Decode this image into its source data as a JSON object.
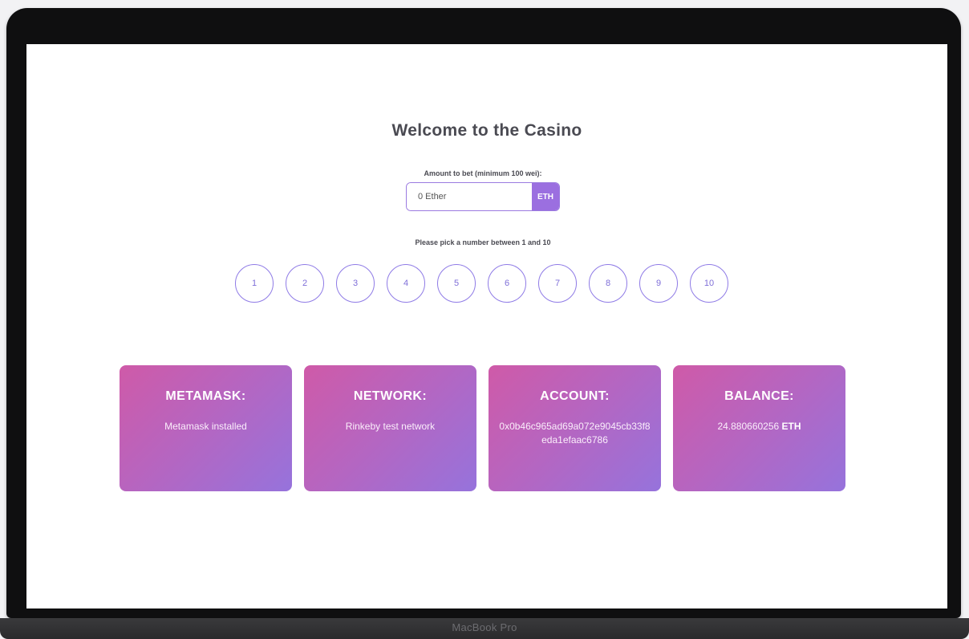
{
  "device": {
    "brand": "MacBook Pro"
  },
  "page": {
    "title": "Welcome to the Casino",
    "bet_label": "Amount to bet (minimum 100 wei):",
    "bet_placeholder": "0 Ether",
    "bet_unit": "ETH",
    "pick_label": "Please pick a number between 1 and 10",
    "numbers": [
      "1",
      "2",
      "3",
      "4",
      "5",
      "6",
      "7",
      "8",
      "9",
      "10"
    ]
  },
  "cards": {
    "metamask": {
      "title": "METAMASK:",
      "value": "Metamask installed"
    },
    "network": {
      "title": "NETWORK:",
      "value": "Rinkeby test network"
    },
    "account": {
      "title": "ACCOUNT:",
      "value": "0x0b46c965ad69a072e9045cb33f8eda1efaac6786"
    },
    "balance": {
      "title": "BALANCE:",
      "value": "24.880660256",
      "unit": "ETH"
    }
  },
  "colors": {
    "accent": "#9b6fe0",
    "number_border": "#8f7be6",
    "card_gradient_start": "#cf5aa8",
    "card_gradient_end": "#9673dc"
  }
}
